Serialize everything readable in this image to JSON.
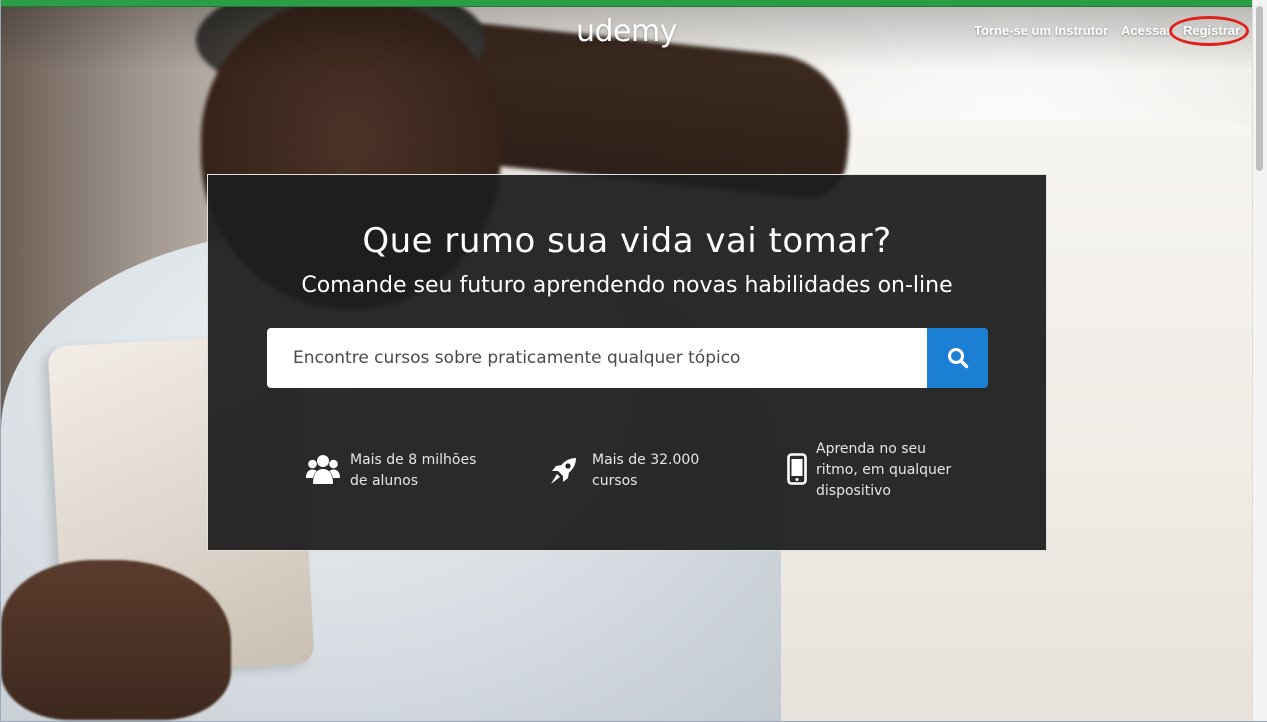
{
  "header": {
    "logo": "udemy",
    "nav": {
      "instructor": "Torne-se um Instrutor",
      "login": "Acessar",
      "register": "Registrar"
    }
  },
  "hero": {
    "title": "Que rumo sua vida vai tomar?",
    "subtitle": "Comande seu futuro aprendendo novas habilidades on-line",
    "search": {
      "placeholder": "Encontre cursos sobre praticamente qualquer tópico",
      "button_icon": "search-icon"
    }
  },
  "features": [
    {
      "icon": "users-icon",
      "line1": "Mais de 8 milhões",
      "line2": "de alunos",
      "line3": ""
    },
    {
      "icon": "rocket-icon",
      "line1": "Mais de 32.000",
      "line2": "cursos",
      "line3": ""
    },
    {
      "icon": "mobile-phone-icon",
      "line1": "Aprenda no seu",
      "line2": "ritmo, em qualquer",
      "line3": "dispositivo"
    }
  ],
  "colors": {
    "accent_blue": "#1b7fd3",
    "top_strip_green": "#2a9d45",
    "highlight_red": "#e0201b",
    "hero_box": "#1e1e1e"
  }
}
